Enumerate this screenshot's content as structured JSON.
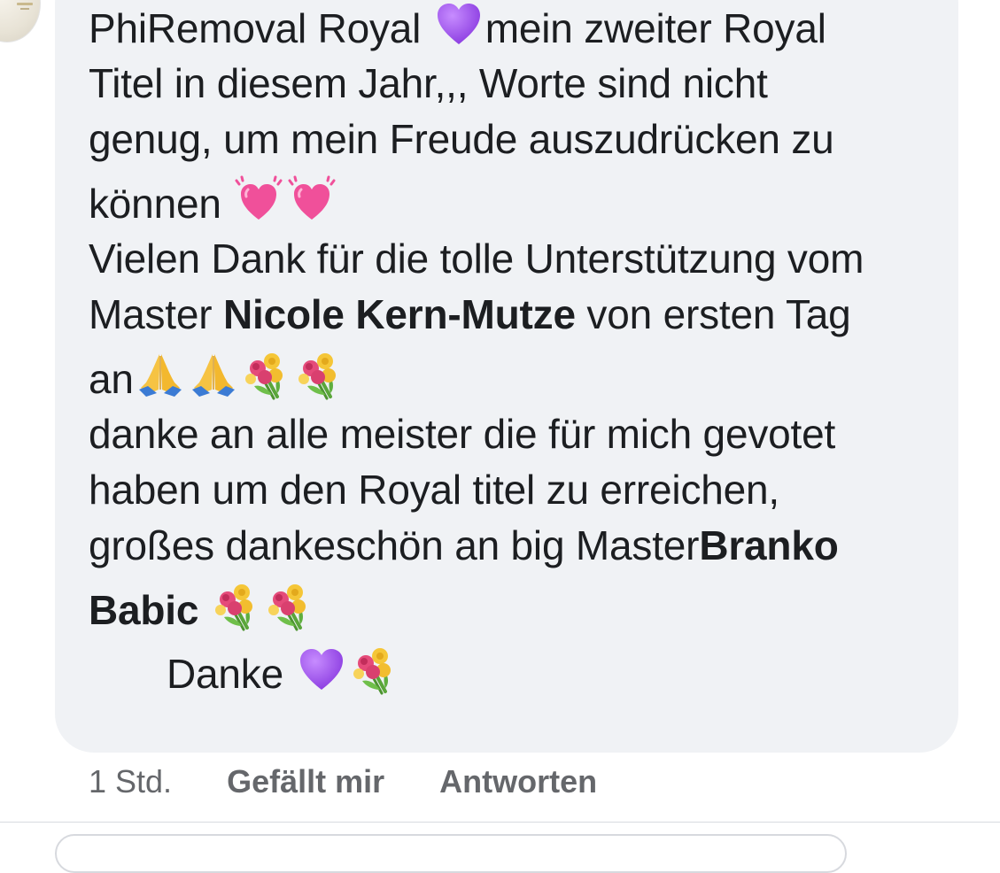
{
  "comment": {
    "lines": [
      {
        "parts": [
          {
            "type": "text",
            "value": "PhiRemoval Royal "
          },
          {
            "type": "emoji",
            "icon": "purple-heart-icon"
          },
          {
            "type": "text",
            "value": "mein zweiter Royal"
          }
        ]
      },
      {
        "parts": [
          {
            "type": "text",
            "value": "Titel in diesem Jahr,,, Worte sind nicht"
          }
        ]
      },
      {
        "parts": [
          {
            "type": "text",
            "value": "genug, um mein Freude auszudrücken zu"
          }
        ]
      },
      {
        "tall": true,
        "parts": [
          {
            "type": "text",
            "value": "können "
          },
          {
            "type": "emoji",
            "icon": "beating-heart-icon"
          },
          {
            "type": "emoji",
            "icon": "beating-heart-icon"
          }
        ]
      },
      {
        "parts": [
          {
            "type": "text",
            "value": "Vielen Dank für die tolle Unterstützung vom"
          }
        ]
      },
      {
        "parts": [
          {
            "type": "text",
            "value": "Master "
          },
          {
            "type": "mention",
            "value": "Nicole Kern-Mutze"
          },
          {
            "type": "text",
            "value": " von ersten Tag"
          }
        ]
      },
      {
        "tall": true,
        "parts": [
          {
            "type": "text",
            "value": "an"
          },
          {
            "type": "emoji",
            "icon": "folded-hands-icon"
          },
          {
            "type": "emoji",
            "icon": "folded-hands-icon"
          },
          {
            "type": "emoji",
            "icon": "bouquet-icon"
          },
          {
            "type": "emoji",
            "icon": "bouquet-icon"
          }
        ]
      },
      {
        "parts": [
          {
            "type": "text",
            "value": "danke an alle meister die für mich gevotet"
          }
        ]
      },
      {
        "parts": [
          {
            "type": "text",
            "value": "haben um den Royal titel zu erreichen,"
          }
        ]
      },
      {
        "parts": [
          {
            "type": "text",
            "value": "großes dankeschön an big Master"
          },
          {
            "type": "mention",
            "value": "Branko"
          }
        ]
      },
      {
        "tall": true,
        "parts": [
          {
            "type": "mention",
            "value": "Babic"
          },
          {
            "type": "text",
            "value": " "
          },
          {
            "type": "emoji",
            "icon": "bouquet-icon"
          },
          {
            "type": "emoji",
            "icon": "bouquet-icon"
          }
        ]
      },
      {
        "tall": true,
        "indent": true,
        "parts": [
          {
            "type": "text",
            "value": "Danke "
          },
          {
            "type": "emoji",
            "icon": "purple-heart-icon"
          },
          {
            "type": "emoji",
            "icon": "bouquet-icon"
          }
        ]
      }
    ]
  },
  "actions": {
    "time": "1 Std.",
    "like_label": "Gefällt mir",
    "reply_label": "Antworten"
  },
  "colors": {
    "bubble": "#f0f2f5",
    "text": "#1c1e21",
    "meta": "#65676b",
    "purple_heart": "#9b4dea",
    "pink_heart": "#f0509a"
  }
}
